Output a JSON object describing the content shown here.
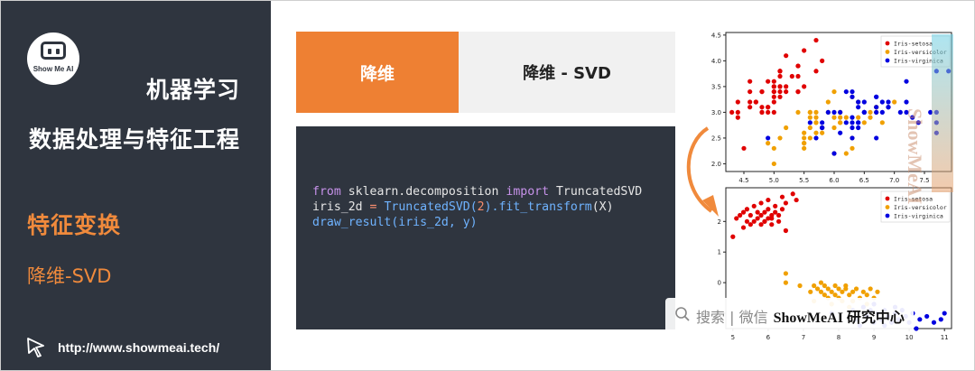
{
  "sidebar": {
    "logo_text": "Show Me AI",
    "course_title": "机器学习",
    "section_title": "数据处理与特征工程",
    "topic": "特征变换",
    "subtopic": "降维-SVD",
    "url": "http://www.showmeai.tech/"
  },
  "tabs": [
    {
      "label": "降维",
      "active": true
    },
    {
      "label": "降维 - SVD",
      "active": false
    }
  ],
  "code": {
    "line1": [
      "from",
      " sklearn.decomposition ",
      "import",
      " TruncatedSVD"
    ],
    "line2": [
      "iris_2d ",
      "=",
      " ",
      "TruncatedSVD(",
      "2",
      ").fit_transform",
      "(X)"
    ],
    "line3": [
      "draw_result(iris_2d, y)"
    ]
  },
  "watermark": {
    "search_icon": "search-icon",
    "search_text": "搜索 | 微信",
    "brand_text": "ShowMeAI 研究中心",
    "vertical_text": "ShowMeAI"
  },
  "colors": {
    "sidebar_bg": "#2f353f",
    "accent": "#ee8033",
    "setosa": "#e00000",
    "versicolor": "#f0a000",
    "virginica": "#0000e0"
  },
  "chart_data": [
    {
      "type": "scatter",
      "title": "",
      "xlabel": "",
      "ylabel": "",
      "xlim": [
        4.2,
        7.95
      ],
      "ylim": [
        1.85,
        4.55
      ],
      "xticks": [
        "4.5",
        "5.0",
        "5.5",
        "6.0",
        "6.5",
        "7.0",
        "7.5"
      ],
      "yticks": [
        "2.0",
        "2.5",
        "3.0",
        "3.5",
        "4.0",
        "4.5"
      ],
      "legend": "top-right",
      "series": [
        {
          "name": "Iris-setosa",
          "color": "#e00000",
          "points": [
            [
              5.1,
              3.5
            ],
            [
              4.9,
              3.0
            ],
            [
              4.7,
              3.2
            ],
            [
              4.6,
              3.1
            ],
            [
              5.0,
              3.6
            ],
            [
              5.4,
              3.9
            ],
            [
              4.6,
              3.4
            ],
            [
              5.0,
              3.4
            ],
            [
              4.4,
              2.9
            ],
            [
              4.9,
              3.1
            ],
            [
              5.4,
              3.7
            ],
            [
              4.8,
              3.4
            ],
            [
              4.8,
              3.0
            ],
            [
              4.3,
              3.0
            ],
            [
              5.8,
              4.0
            ],
            [
              5.7,
              4.4
            ],
            [
              5.4,
              3.9
            ],
            [
              5.1,
              3.5
            ],
            [
              5.7,
              3.8
            ],
            [
              5.1,
              3.8
            ],
            [
              5.4,
              3.4
            ],
            [
              5.1,
              3.7
            ],
            [
              4.6,
              3.6
            ],
            [
              5.1,
              3.3
            ],
            [
              4.8,
              3.4
            ],
            [
              5.0,
              3.0
            ],
            [
              5.0,
              3.4
            ],
            [
              5.2,
              3.5
            ],
            [
              5.2,
              3.4
            ],
            [
              4.7,
              3.2
            ],
            [
              4.8,
              3.1
            ],
            [
              5.4,
              3.4
            ],
            [
              5.2,
              4.1
            ],
            [
              5.5,
              4.2
            ],
            [
              4.9,
              3.1
            ],
            [
              5.0,
              3.2
            ],
            [
              5.5,
              3.5
            ],
            [
              4.9,
              3.6
            ],
            [
              4.4,
              3.0
            ],
            [
              5.1,
              3.4
            ],
            [
              5.0,
              3.5
            ],
            [
              4.5,
              2.3
            ],
            [
              4.4,
              3.2
            ],
            [
              5.0,
              3.5
            ],
            [
              5.1,
              3.8
            ],
            [
              4.8,
              3.0
            ],
            [
              5.1,
              3.8
            ],
            [
              4.6,
              3.2
            ],
            [
              5.3,
              3.7
            ],
            [
              5.0,
              3.3
            ]
          ]
        },
        {
          "name": "Iris-versicolor",
          "color": "#f0a000",
          "points": [
            [
              7.0,
              3.2
            ],
            [
              6.4,
              3.2
            ],
            [
              6.9,
              3.1
            ],
            [
              5.5,
              2.3
            ],
            [
              6.5,
              2.8
            ],
            [
              5.7,
              2.8
            ],
            [
              6.3,
              3.3
            ],
            [
              4.9,
              2.4
            ],
            [
              6.6,
              2.9
            ],
            [
              5.2,
              2.7
            ],
            [
              5.0,
              2.0
            ],
            [
              5.9,
              3.0
            ],
            [
              6.0,
              2.2
            ],
            [
              6.1,
              2.9
            ],
            [
              5.6,
              2.9
            ],
            [
              6.7,
              3.1
            ],
            [
              5.6,
              3.0
            ],
            [
              5.8,
              2.7
            ],
            [
              6.2,
              2.2
            ],
            [
              5.6,
              2.5
            ],
            [
              5.9,
              3.2
            ],
            [
              6.1,
              2.8
            ],
            [
              6.3,
              2.5
            ],
            [
              6.1,
              2.8
            ],
            [
              6.4,
              2.9
            ],
            [
              6.6,
              3.0
            ],
            [
              6.8,
              2.8
            ],
            [
              6.7,
              3.0
            ],
            [
              6.0,
              2.9
            ],
            [
              5.7,
              2.6
            ],
            [
              5.5,
              2.4
            ],
            [
              5.5,
              2.4
            ],
            [
              5.8,
              2.7
            ],
            [
              6.0,
              2.7
            ],
            [
              5.4,
              3.0
            ],
            [
              6.0,
              3.4
            ],
            [
              6.7,
              3.1
            ],
            [
              6.3,
              2.3
            ],
            [
              5.6,
              3.0
            ],
            [
              5.5,
              2.5
            ],
            [
              5.5,
              2.6
            ],
            [
              6.1,
              3.0
            ],
            [
              5.8,
              2.6
            ],
            [
              5.0,
              2.3
            ],
            [
              5.6,
              2.7
            ],
            [
              5.7,
              3.0
            ],
            [
              5.7,
              2.9
            ],
            [
              6.2,
              2.9
            ],
            [
              5.1,
              2.5
            ],
            [
              5.7,
              2.8
            ]
          ]
        },
        {
          "name": "Iris-virginica",
          "color": "#0000e0",
          "points": [
            [
              6.3,
              3.3
            ],
            [
              5.8,
              2.7
            ],
            [
              7.1,
              3.0
            ],
            [
              6.3,
              2.9
            ],
            [
              6.5,
              3.0
            ],
            [
              7.6,
              3.0
            ],
            [
              4.9,
              2.5
            ],
            [
              7.3,
              2.9
            ],
            [
              6.7,
              2.5
            ],
            [
              7.2,
              3.6
            ],
            [
              6.5,
              3.2
            ],
            [
              6.4,
              2.7
            ],
            [
              6.8,
              3.0
            ],
            [
              5.7,
              2.5
            ],
            [
              5.8,
              2.8
            ],
            [
              6.4,
              3.2
            ],
            [
              6.5,
              3.0
            ],
            [
              7.7,
              3.8
            ],
            [
              7.7,
              2.6
            ],
            [
              6.0,
              2.2
            ],
            [
              6.9,
              3.2
            ],
            [
              5.6,
              2.8
            ],
            [
              7.7,
              2.8
            ],
            [
              6.3,
              2.7
            ],
            [
              6.7,
              3.3
            ],
            [
              7.2,
              3.2
            ],
            [
              6.2,
              2.8
            ],
            [
              6.1,
              3.0
            ],
            [
              6.4,
              2.8
            ],
            [
              7.2,
              3.0
            ],
            [
              7.4,
              2.8
            ],
            [
              7.9,
              3.8
            ],
            [
              6.4,
              2.8
            ],
            [
              6.3,
              2.8
            ],
            [
              6.1,
              2.6
            ],
            [
              7.7,
              3.0
            ],
            [
              6.3,
              3.4
            ],
            [
              6.4,
              3.1
            ],
            [
              6.0,
              3.0
            ],
            [
              6.9,
              3.1
            ],
            [
              6.7,
              3.1
            ],
            [
              6.9,
              3.1
            ],
            [
              5.8,
              2.7
            ],
            [
              6.8,
              3.2
            ],
            [
              6.7,
              3.3
            ],
            [
              6.7,
              3.0
            ],
            [
              6.3,
              2.5
            ],
            [
              6.5,
              3.0
            ],
            [
              6.2,
              3.4
            ],
            [
              5.9,
              3.0
            ]
          ]
        }
      ]
    },
    {
      "type": "scatter",
      "title": "",
      "xlabel": "",
      "ylabel": "",
      "xlim": [
        4.8,
        11.2
      ],
      "ylim": [
        -1.5,
        3.1
      ],
      "xticks": [
        "5",
        "6",
        "7",
        "8",
        "9",
        "10",
        "11"
      ],
      "yticks": [
        "-1",
        "0",
        "1",
        "2"
      ],
      "legend": "top-right",
      "series": [
        {
          "name": "Iris-setosa",
          "color": "#e00000",
          "points": [
            [
              5.0,
              1.5
            ],
            [
              5.1,
              2.1
            ],
            [
              5.2,
              2.2
            ],
            [
              5.3,
              1.8
            ],
            [
              5.3,
              2.3
            ],
            [
              5.4,
              2.0
            ],
            [
              5.4,
              2.4
            ],
            [
              5.5,
              1.9
            ],
            [
              5.5,
              2.2
            ],
            [
              5.6,
              2.0
            ],
            [
              5.6,
              2.5
            ],
            [
              5.7,
              2.1
            ],
            [
              5.7,
              2.3
            ],
            [
              5.8,
              1.9
            ],
            [
              5.8,
              2.2
            ],
            [
              5.8,
              2.6
            ],
            [
              5.9,
              2.0
            ],
            [
              5.9,
              2.3
            ],
            [
              6.0,
              2.1
            ],
            [
              6.0,
              2.4
            ],
            [
              6.0,
              2.7
            ],
            [
              6.1,
              2.2
            ],
            [
              6.1,
              1.9
            ],
            [
              6.2,
              2.3
            ],
            [
              6.2,
              2.5
            ],
            [
              6.3,
              2.0
            ],
            [
              6.3,
              2.2
            ],
            [
              6.4,
              2.4
            ],
            [
              6.4,
              2.8
            ],
            [
              6.5,
              1.7
            ],
            [
              6.5,
              2.6
            ],
            [
              6.7,
              2.9
            ],
            [
              6.8,
              2.7
            ],
            [
              5.9,
              2.0
            ],
            [
              6.1,
              2.1
            ]
          ]
        },
        {
          "name": "Iris-versicolor",
          "color": "#f0a000",
          "points": [
            [
              6.5,
              0.3
            ],
            [
              6.5,
              0.0
            ],
            [
              6.9,
              -0.1
            ],
            [
              7.2,
              -0.3
            ],
            [
              7.3,
              -0.1
            ],
            [
              7.4,
              -0.2
            ],
            [
              7.5,
              -0.3
            ],
            [
              7.6,
              -0.1
            ],
            [
              7.6,
              -0.4
            ],
            [
              7.7,
              -0.2
            ],
            [
              7.7,
              -0.5
            ],
            [
              7.8,
              -0.3
            ],
            [
              7.9,
              -0.1
            ],
            [
              7.9,
              -0.4
            ],
            [
              8.0,
              -0.2
            ],
            [
              8.0,
              -0.5
            ],
            [
              8.1,
              -0.3
            ],
            [
              8.1,
              -0.6
            ],
            [
              8.2,
              -0.2
            ],
            [
              8.3,
              -0.4
            ],
            [
              8.4,
              -0.3
            ],
            [
              8.4,
              -0.6
            ],
            [
              8.5,
              -0.2
            ],
            [
              8.6,
              -0.5
            ],
            [
              8.7,
              -0.3
            ],
            [
              8.8,
              -0.4
            ],
            [
              8.9,
              -0.2
            ],
            [
              9.0,
              -0.5
            ],
            [
              9.1,
              -0.3
            ],
            [
              7.3,
              -0.6
            ],
            [
              7.8,
              -0.7
            ],
            [
              8.3,
              -0.8
            ],
            [
              8.8,
              -0.7
            ],
            [
              7.5,
              0.0
            ],
            [
              8.2,
              -0.1
            ]
          ]
        },
        {
          "name": "Iris-virginica",
          "color": "#0000e0",
          "points": [
            [
              7.8,
              -1.0
            ],
            [
              8.4,
              -0.9
            ],
            [
              8.5,
              -1.2
            ],
            [
              8.7,
              -0.8
            ],
            [
              8.8,
              -1.1
            ],
            [
              8.9,
              -0.9
            ],
            [
              9.0,
              -1.3
            ],
            [
              9.1,
              -1.0
            ],
            [
              9.2,
              -1.2
            ],
            [
              9.3,
              -0.9
            ],
            [
              9.4,
              -1.1
            ],
            [
              9.5,
              -1.3
            ],
            [
              9.6,
              -1.0
            ],
            [
              9.7,
              -1.2
            ],
            [
              9.8,
              -0.9
            ],
            [
              9.9,
              -1.1
            ],
            [
              10.0,
              -1.3
            ],
            [
              10.1,
              -1.0
            ],
            [
              10.3,
              -1.2
            ],
            [
              10.5,
              -1.1
            ],
            [
              10.7,
              -1.3
            ],
            [
              10.9,
              -1.2
            ],
            [
              11.0,
              -1.0
            ],
            [
              8.6,
              -1.4
            ],
            [
              9.3,
              -1.4
            ],
            [
              9.0,
              -0.7
            ],
            [
              10.2,
              -1.5
            ],
            [
              9.6,
              -0.8
            ]
          ]
        }
      ]
    }
  ]
}
